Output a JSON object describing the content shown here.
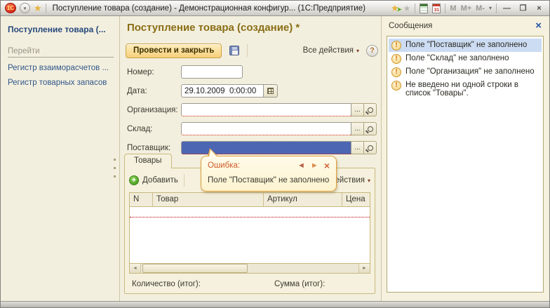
{
  "colors": {
    "selection_fill": "#4d66b4",
    "required_underline": "#cc2200",
    "tooltip_border": "#dfa13f",
    "link": "#30578a",
    "form_title": "#8a6e16",
    "message_selection": "#ccdcf3"
  },
  "titlebar": {
    "logo": "1С",
    "title": "Поступление товара (создание) - Демонстрационная конфигур...  (1С:Предприятие)",
    "memory": [
      "M",
      "M+",
      "M-"
    ]
  },
  "sidebar": {
    "title": "Поступление товара (...",
    "section": "Перейти",
    "links": [
      "Регистр взаиморасчетов ...",
      "Регистр товарных запасов"
    ]
  },
  "form": {
    "title": "Поступление товара (создание) *",
    "post_and_close": "Провести и закрыть",
    "all_actions": "Все действия",
    "help": "?",
    "lookup_button": "...",
    "fields": {
      "number": {
        "label": "Номер:",
        "value": ""
      },
      "date": {
        "label": "Дата:",
        "value": "29.10.2009  0:00:00"
      },
      "organization": {
        "label": "Организация:",
        "value": ""
      },
      "warehouse": {
        "label": "Склад:",
        "value": ""
      },
      "supplier": {
        "label": "Поставщик:",
        "value": ""
      }
    },
    "tab": "Товары",
    "add": "Добавить",
    "columns": [
      "N",
      "Товар",
      "Артикул",
      "Цена"
    ],
    "totals": {
      "quantity": "Количество (итог):",
      "sum": "Сумма (итог):"
    }
  },
  "tooltip": {
    "title": "Ошибка:",
    "message": "Поле \"Поставщик\" не заполнено"
  },
  "messages": {
    "title": "Сообщения",
    "items": [
      "Поле \"Поставщик\" не заполнено",
      "Поле \"Склад\" не заполнено",
      "Поле \"Организация\" не заполнено",
      "Не введено ни одной строки в список \"Товары\"."
    ]
  },
  "icons": {
    "dropdown": "▾",
    "prev": "◄",
    "next": "►",
    "close": "×",
    "star": "★",
    "minimize": "—",
    "maximize": "❐",
    "window_close": "×",
    "scroll_left": "◄",
    "scroll_right": "►"
  }
}
